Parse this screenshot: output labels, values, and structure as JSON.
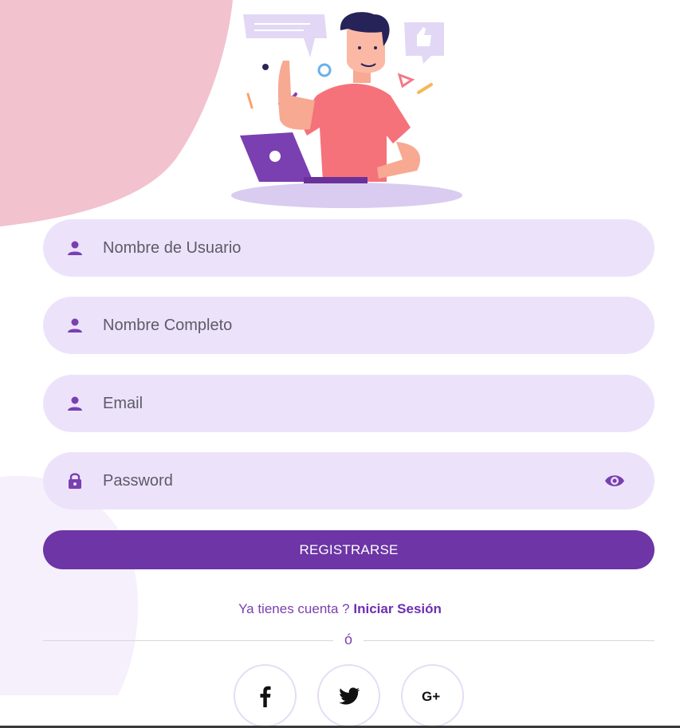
{
  "colors": {
    "accent": "#6d35a6",
    "field_background": "#ece3fb",
    "blob_pink": "#f2c2cf",
    "blob_lavender": "#f6f0fc"
  },
  "form": {
    "username": {
      "placeholder": "Nombre de Usuario",
      "icon": "person-icon"
    },
    "fullname": {
      "placeholder": "Nombre Completo",
      "icon": "person-icon"
    },
    "email": {
      "placeholder": "Email",
      "icon": "person-icon"
    },
    "password": {
      "placeholder": "Password",
      "icon": "lock-icon",
      "toggle_icon": "eye-icon"
    }
  },
  "register_button": {
    "label": "REGISTRARSE"
  },
  "account": {
    "prompt": "Ya tienes cuenta ? ",
    "login_link": "Iniciar Sesión"
  },
  "divider": {
    "label": "ó"
  },
  "social": [
    {
      "name": "facebook",
      "icon": "facebook-icon"
    },
    {
      "name": "twitter",
      "icon": "twitter-icon"
    },
    {
      "name": "google-plus",
      "icon": "google-plus-icon"
    }
  ]
}
